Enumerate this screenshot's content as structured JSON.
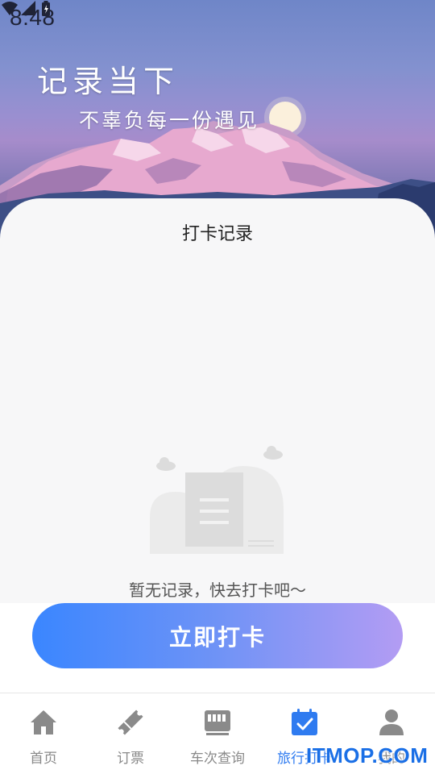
{
  "status_bar": {
    "time": "8:48",
    "icons": [
      "wifi-icon",
      "signal-icon",
      "battery-icon"
    ]
  },
  "hero": {
    "title": "记录当下",
    "subtitle": "不辜负每一份遇见"
  },
  "card": {
    "title": "打卡记录",
    "empty_text": "暂无记录，快去打卡吧～"
  },
  "checkin_button": {
    "label": "立即打卡"
  },
  "bottom_nav": {
    "items": [
      {
        "label": "首页",
        "icon": "home-icon"
      },
      {
        "label": "订票",
        "icon": "ticket-icon"
      },
      {
        "label": "车次查询",
        "icon": "train-icon"
      },
      {
        "label": "旅行打卡",
        "icon": "calendar-check-icon",
        "active": true
      },
      {
        "label": "我的",
        "icon": "user-icon"
      }
    ]
  },
  "watermark": "ITMOP.COM",
  "colors": {
    "accent": "#2f7bf0",
    "button_gradient_start": "#3a86ff",
    "button_gradient_end": "#b39cf3",
    "inactive": "#8a8a8a"
  }
}
